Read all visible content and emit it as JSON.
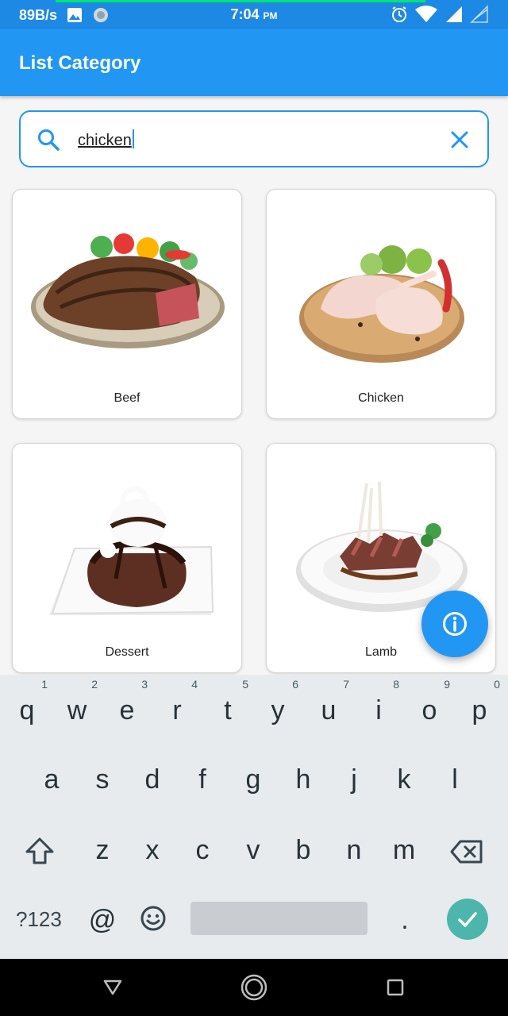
{
  "status_bar": {
    "speed": "89B/s",
    "time": "7:04",
    "ampm": "PM"
  },
  "app_bar": {
    "title": "List Category"
  },
  "search": {
    "value": "chicken"
  },
  "categories": [
    {
      "label": "Beef"
    },
    {
      "label": "Chicken"
    },
    {
      "label": "Dessert"
    },
    {
      "label": "Lamb"
    }
  ],
  "keyboard": {
    "row1": [
      "q",
      "w",
      "e",
      "r",
      "t",
      "y",
      "u",
      "i",
      "o",
      "p"
    ],
    "row1_hints": [
      "1",
      "2",
      "3",
      "4",
      "5",
      "6",
      "7",
      "8",
      "9",
      "0"
    ],
    "row2": [
      "a",
      "s",
      "d",
      "f",
      "g",
      "h",
      "j",
      "k",
      "l"
    ],
    "row3": [
      "z",
      "x",
      "c",
      "v",
      "b",
      "n",
      "m"
    ],
    "symbols_key": "?123",
    "at_key": "@",
    "period_key": "."
  },
  "colors": {
    "primary": "#2196f3",
    "status_bar": "#1e88e5",
    "ok_button": "#4db6ac"
  }
}
